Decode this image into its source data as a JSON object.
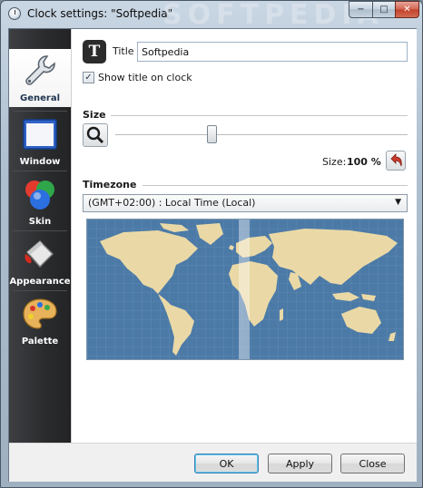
{
  "window": {
    "title": "Clock settings: \"Softpedia\"",
    "watermark": "SOFTPEDIA",
    "controls": {
      "minimize": "−",
      "maximize": "□",
      "close": "✕"
    }
  },
  "sidebar": {
    "items": [
      {
        "label": "General",
        "icon": "wrench-icon",
        "active": true
      },
      {
        "label": "Window",
        "icon": "window-icon",
        "active": false
      },
      {
        "label": "Skin",
        "icon": "color-balls-icon",
        "active": false
      },
      {
        "label": "Appearance",
        "icon": "paint-bucket-icon",
        "active": false
      },
      {
        "label": "Palette",
        "icon": "palette-icon",
        "active": false
      }
    ]
  },
  "general": {
    "title_icon_glyph": "T",
    "title_label": "Title",
    "title_value": "Softpedia",
    "show_title_label": "Show title on clock",
    "show_title_checked": true,
    "size_heading": "Size",
    "size_label": "Size:",
    "size_value": "100 %",
    "size_slider_fraction": 0.33,
    "timezone_heading": "Timezone",
    "timezone_selected": "(GMT+02:00) : Local Time (Local)"
  },
  "colors": {
    "sidebar_bg": "#2a2b2d",
    "map_ocean": "#4c7aa7",
    "map_land": "#ead9a6",
    "default_button_border": "#3c7fb1"
  },
  "buttons": {
    "ok": "OK",
    "apply": "Apply",
    "close": "Close"
  }
}
